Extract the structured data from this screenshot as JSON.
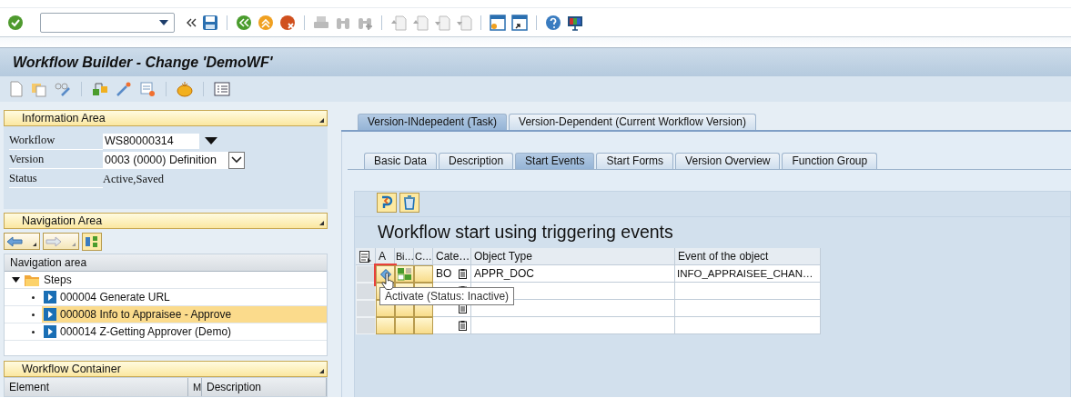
{
  "title": "Workflow Builder - Change 'DemoWF'",
  "information_area": {
    "title": "Information Area",
    "fields": [
      {
        "label": "Workflow",
        "value": "WS80000314",
        "kind": "input"
      },
      {
        "label": "Version",
        "value": "0003 (0000) Definition",
        "kind": "dropdown"
      },
      {
        "label": "Status",
        "value": "Active,Saved",
        "kind": "text"
      }
    ]
  },
  "navigation_area": {
    "title": "Navigation Area",
    "tree_header": "Navigation area",
    "tree": [
      {
        "label": "Steps",
        "expanded": true,
        "children": [
          {
            "label": "000004 Generate URL",
            "selected": false
          },
          {
            "label": "000008 Info to Appraisee - Approve",
            "selected": true
          },
          {
            "label": "000014 Z-Getting Approver (Demo)",
            "selected": false
          }
        ]
      }
    ]
  },
  "workflow_container": {
    "title": "Workflow Container",
    "columns": [
      "Element",
      "M",
      "Description"
    ]
  },
  "tabs": [
    {
      "label": "Version-INdepedent (Task)",
      "selected": true
    },
    {
      "label": "Version-Dependent (Current Workflow Version)",
      "selected": false
    }
  ],
  "subtabs": [
    {
      "label": "Basic Data",
      "selected": false
    },
    {
      "label": "Description",
      "selected": false
    },
    {
      "label": "Start Events",
      "selected": true
    },
    {
      "label": "Start Forms",
      "selected": false
    },
    {
      "label": "Version Overview",
      "selected": false
    },
    {
      "label": "Function Group",
      "selected": false
    }
  ],
  "start_events": {
    "heading": "Workflow start using triggering events",
    "columns": [
      "A",
      "Bi…",
      "C…",
      "Cate…",
      "Object Type",
      "Event of the object"
    ],
    "rows": [
      {
        "kind": "event",
        "category": "BO",
        "object_type": "APPR_DOC",
        "event": "INFO_APPRAISEE_CHAN…",
        "highlighted": true
      },
      {
        "kind": "empty"
      },
      {
        "kind": "empty"
      },
      {
        "kind": "empty"
      }
    ],
    "tooltip": "Activate (Status: Inactive)"
  }
}
